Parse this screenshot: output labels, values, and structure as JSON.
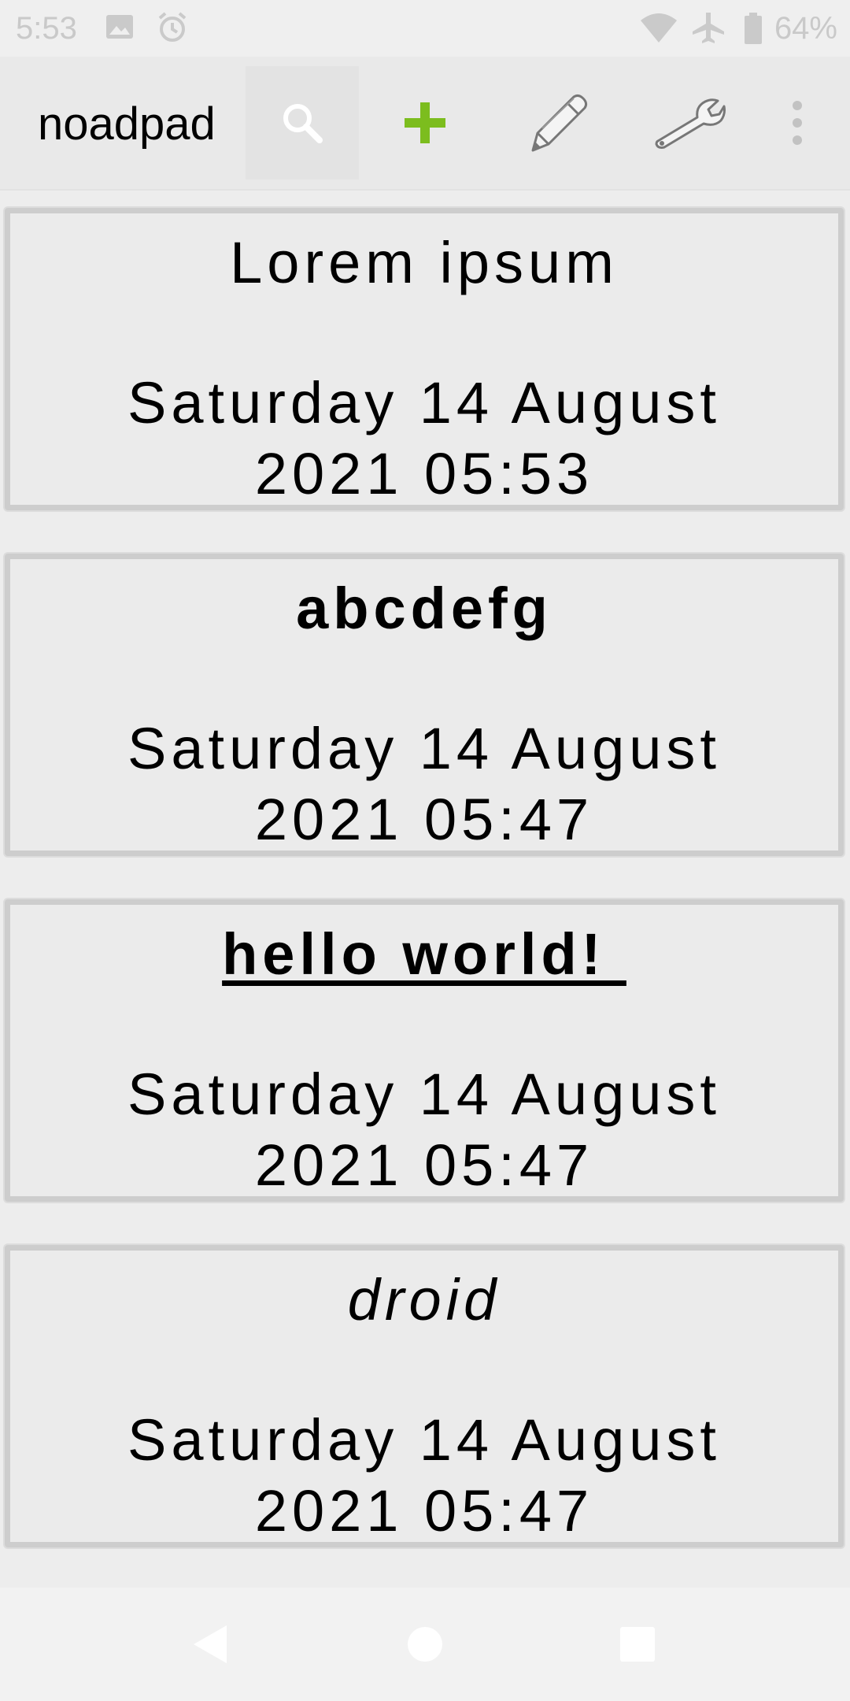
{
  "status_bar": {
    "time": "5:53",
    "battery": "64%",
    "icons": [
      "image-icon",
      "alarm-icon",
      "wifi-icon",
      "airplane-icon",
      "battery-icon"
    ]
  },
  "app_bar": {
    "title": "noadpad",
    "actions": [
      "search-icon",
      "add-icon",
      "pencil-icon",
      "wrench-icon",
      "overflow-menu-icon"
    ],
    "accent_color": "#7cbd1e"
  },
  "notes": [
    {
      "title": "Lorem ipsum",
      "style": "normal",
      "date_line1": "Saturday 14 August",
      "date_line2": "2021 05:53"
    },
    {
      "title": "abcdefg",
      "style": "bold",
      "date_line1": "Saturday 14 August",
      "date_line2": "2021 05:47"
    },
    {
      "title": "hello world! ",
      "style": "bold-underline",
      "date_line1": "Saturday 14 August",
      "date_line2": "2021 05:47"
    },
    {
      "title": "droid",
      "style": "italic",
      "date_line1": "Saturday 14 August",
      "date_line2": "2021 05:47"
    }
  ],
  "nav_bar": {
    "buttons": [
      "back-icon",
      "home-icon",
      "recents-icon"
    ]
  }
}
